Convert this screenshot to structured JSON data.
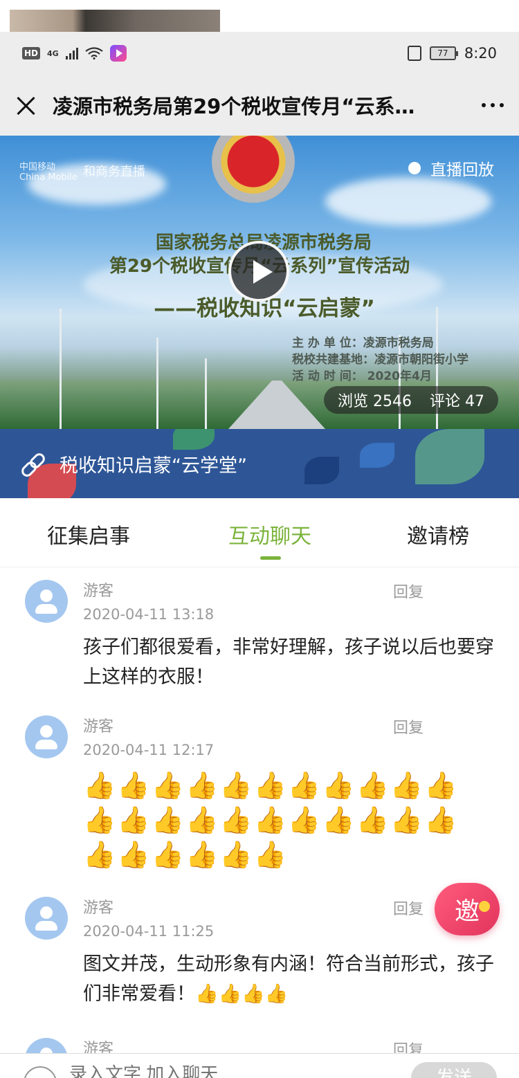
{
  "status_bar": {
    "hd": "HD",
    "network": "4G",
    "battery": "77",
    "time": "8:20"
  },
  "nav": {
    "title": "凌源市税务局第29个税收宣传月“云系…"
  },
  "banner": {
    "logo_carrier": "中国移动",
    "logo_carrier_en": "China Mobile",
    "logo_live": "和商务直播",
    "replay_label": "直播回放",
    "line1": "国家税务总局凌源市税务局",
    "line2": "第29个税收宣传月“云系列”宣传活动",
    "line3": "——税收知识“云启蒙”",
    "info": [
      "主 办 单 位：凌源市税务局",
      "税校共建基地：凌源市朝阳街小学",
      "活 动 时 间：  2020年4月"
    ],
    "views_label": "浏览 2546",
    "comments_label": "评论 47"
  },
  "link_bar": {
    "text": "税收知识启蒙“云学堂”"
  },
  "tabs": [
    {
      "label": "征集启事",
      "active": false
    },
    {
      "label": "互动聊天",
      "active": true
    },
    {
      "label": "邀请榜",
      "active": false
    }
  ],
  "comments": [
    {
      "name": "游客",
      "time": "2020-04-11 13:18",
      "reply": "回复",
      "text": "孩子们都很爱看，非常好理解，孩子说以后也要穿上这样的衣服！"
    },
    {
      "name": "游客",
      "time": "2020-04-11 12:17",
      "reply": "回复",
      "text": "👍👍👍👍👍👍👍👍👍👍👍👍👍👍👍👍👍👍👍👍👍👍👍👍👍👍👍👍"
    },
    {
      "name": "游客",
      "time": "2020-04-11 11:25",
      "reply": "回复",
      "text": "图文并茂，生动形象有内涵！符合当前形式，孩子们非常爱看！👍👍👍👍"
    },
    {
      "name": "游客",
      "time": "",
      "reply": "回复",
      "text": ""
    }
  ],
  "invite_button": {
    "label": "邀"
  },
  "input_bar": {
    "placeholder": "录入文字 加入聊天",
    "send_label": "发送"
  },
  "colors": {
    "accent_green": "#7bb33b",
    "link_bar_blue": "#2e5697",
    "invite_pink": "#e2345d"
  }
}
